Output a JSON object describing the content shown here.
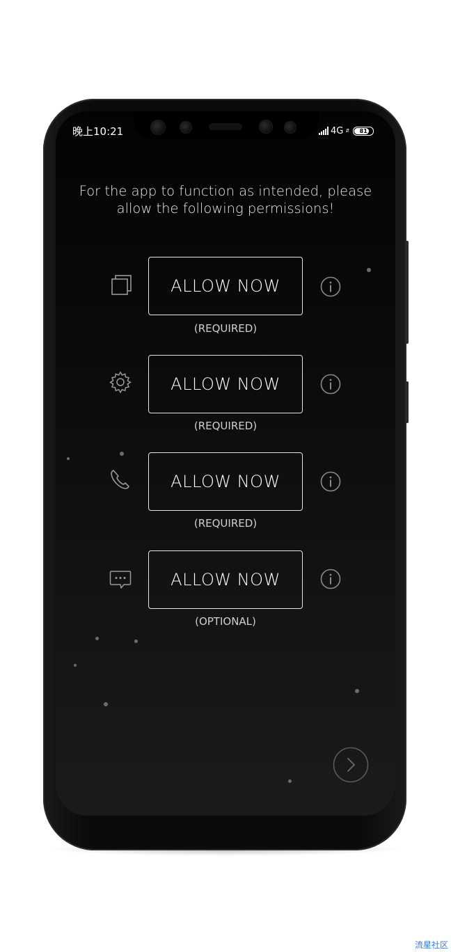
{
  "status_bar": {
    "time": "晚上10:21",
    "network": "4G",
    "battery": "81",
    "battery_level_percent": 81
  },
  "intro_text": "For the app to function as intended, please allow the following permissions!",
  "permissions": [
    {
      "icon": "overlay-windows-icon",
      "button_label": "ALLOW NOW",
      "status_label": "(REQUIRED)"
    },
    {
      "icon": "gear-icon",
      "button_label": "ALLOW NOW",
      "status_label": "(REQUIRED)"
    },
    {
      "icon": "phone-icon",
      "button_label": "ALLOW NOW",
      "status_label": "(REQUIRED)"
    },
    {
      "icon": "sms-bubble-icon",
      "button_label": "ALLOW NOW",
      "status_label": "(OPTIONAL)"
    }
  ],
  "next_button_icon": "chevron-right-icon",
  "watermark": "流星社区",
  "colors": {
    "screen_background": "#0c0c0c",
    "button_border": "#e6e6e6",
    "icon_grey": "#9a9a9a",
    "watermark_blue": "#3a7bd5"
  }
}
